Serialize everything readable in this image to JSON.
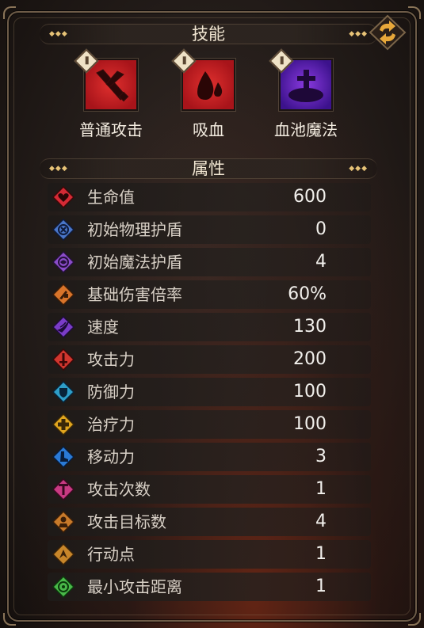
{
  "skills_section": {
    "title": "技能",
    "skills": [
      {
        "name": "普通攻击",
        "icon": "sword-attack-icon",
        "color": "#c0161a"
      },
      {
        "name": "吸血",
        "icon": "blood-drop-icon",
        "color": "#c0161a"
      },
      {
        "name": "血池魔法",
        "icon": "blood-pool-cross-icon",
        "color": "#5a22b0"
      }
    ]
  },
  "attributes_section": {
    "title": "属性",
    "stats": [
      {
        "label": "生命值",
        "value": "600",
        "icon": "heart-icon",
        "color": "#d42a35"
      },
      {
        "label": "初始物理护盾",
        "value": "0",
        "icon": "physical-shield-icon",
        "color": "#4a76c8"
      },
      {
        "label": "初始魔法护盾",
        "value": "4",
        "icon": "magic-shield-icon",
        "color": "#8a4cc8"
      },
      {
        "label": "基础伤害倍率",
        "value": "60%",
        "icon": "damage-multiplier-icon",
        "color": "#d8742a"
      },
      {
        "label": "速度",
        "value": "130",
        "icon": "speed-icon",
        "color": "#7a3cc8"
      },
      {
        "label": "攻击力",
        "value": "200",
        "icon": "attack-icon",
        "color": "#d0362e"
      },
      {
        "label": "防御力",
        "value": "100",
        "icon": "defense-icon",
        "color": "#2e9ec8"
      },
      {
        "label": "治疗力",
        "value": "100",
        "icon": "heal-icon",
        "color": "#e0a51e"
      },
      {
        "label": "移动力",
        "value": "3",
        "icon": "boot-move-icon",
        "color": "#2a7ad6"
      },
      {
        "label": "攻击次数",
        "value": "1",
        "icon": "attack-count-icon",
        "color": "#c83a82"
      },
      {
        "label": "攻击目标数",
        "value": "4",
        "icon": "target-count-icon",
        "color": "#c87a2a"
      },
      {
        "label": "行动点",
        "value": "1",
        "icon": "action-point-icon",
        "color": "#c8862a"
      },
      {
        "label": "最小攻击距离",
        "value": "1",
        "icon": "min-range-icon",
        "color": "#4ab84a"
      }
    ]
  },
  "swap_button": {
    "icon": "swap-arrows-icon",
    "color": "#e8a83a"
  }
}
